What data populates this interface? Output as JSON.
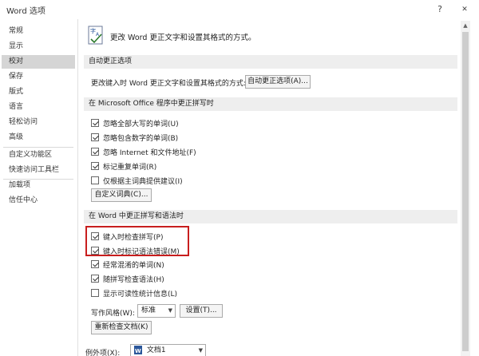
{
  "window": {
    "title": "Word 选项",
    "help_label": "?",
    "close_label": "✕"
  },
  "sidebar": {
    "items": [
      {
        "label": "常规"
      },
      {
        "label": "显示"
      },
      {
        "label": "校对",
        "active": true
      },
      {
        "label": "保存"
      },
      {
        "label": "版式"
      },
      {
        "label": "语言"
      },
      {
        "label": "轻松访问"
      },
      {
        "label": "高级"
      },
      {
        "label": "自定义功能区"
      },
      {
        "label": "快速访问工具栏"
      },
      {
        "label": "加载项"
      },
      {
        "label": "信任中心"
      }
    ]
  },
  "header": {
    "text": "更改 Word 更正文字和设置其格式的方式。"
  },
  "autocorrect": {
    "section_title": "自动更正选项",
    "description": "更改键入时 Word 更正文字和设置其格式的方式:",
    "button": "自动更正选项(A)..."
  },
  "office_spelling": {
    "section_title": "在 Microsoft Office 程序中更正拼写时",
    "options": [
      {
        "label": "忽略全部大写的单词(U)",
        "checked": true
      },
      {
        "label": "忽略包含数字的单词(B)",
        "checked": true
      },
      {
        "label": "忽略 Internet 和文件地址(F)",
        "checked": true
      },
      {
        "label": "标记重复单词(R)",
        "checked": true
      },
      {
        "label": "仅根据主词典提供建议(I)",
        "checked": false
      }
    ],
    "dict_button": "自定义词典(C)..."
  },
  "word_spelling": {
    "section_title": "在 Word 中更正拼写和语法时",
    "options": [
      {
        "label": "键入时检查拼写(P)",
        "checked": true
      },
      {
        "label": "键入时标记语法错误(M)",
        "checked": true
      },
      {
        "label": "经常混淆的单词(N)",
        "checked": true
      },
      {
        "label": "随拼写检查语法(H)",
        "checked": true
      },
      {
        "label": "显示可读性统计信息(L)",
        "checked": false
      }
    ],
    "style_label": "写作风格(W):",
    "style_value": "标准",
    "settings_button": "设置(T)...",
    "recheck_button": "重新检查文档(K)"
  },
  "exceptions": {
    "label": "例外项(X):",
    "document": "文档1"
  },
  "colors": {
    "highlight": "#c81e1e",
    "active_item": "#d5d5d5",
    "section_bg": "#eeeeee"
  }
}
